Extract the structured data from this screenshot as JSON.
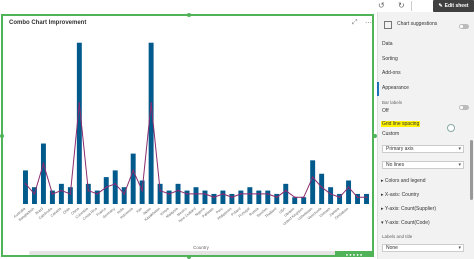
{
  "toolbar": {
    "undo_icon": "undo-icon",
    "redo_icon": "redo-icon",
    "edit_sheet_label": "Edit sheet"
  },
  "chart": {
    "title": "Combo Chart Improvement",
    "xlabel": "Country",
    "status_text": "● ● ● ● ●"
  },
  "chart_data": {
    "type": "bar",
    "categories": [
      "Australia",
      "Bangladesh",
      "Brazil",
      "Cambodia",
      "Canada",
      "Chile",
      "China",
      "Colombia",
      "Costa Rica",
      "France",
      "Germany",
      "India",
      "Indonesia",
      "Iran",
      "Japan",
      "Kazakhstan",
      "Kenya",
      "Malaysia",
      "Mexico",
      "New Zealand",
      "Nigeria",
      "Pakistan",
      "Peru",
      "Philippines",
      "Poland",
      "Portugal",
      "Russia",
      "Sweden",
      "Thailand",
      "USA",
      "Ukraine",
      "United Kingdom",
      "Uzbekistan",
      "Venezuela",
      "Vietnam",
      "Zambia",
      "Zimbabwe"
    ],
    "series": [
      {
        "type": "bar",
        "values": [
          10,
          5,
          18,
          4,
          6,
          5,
          48,
          6,
          4,
          8,
          10,
          5,
          15,
          7,
          48,
          6,
          4,
          6,
          4,
          5,
          4,
          3,
          4,
          3,
          4,
          5,
          4,
          4,
          3,
          6,
          2,
          2,
          13,
          9,
          5,
          3,
          7,
          3,
          3
        ]
      },
      {
        "type": "line",
        "values": [
          6,
          3,
          12,
          3,
          4,
          3,
          30,
          4,
          3,
          5,
          6,
          3,
          10,
          4,
          30,
          4,
          3,
          4,
          3,
          3,
          3,
          2,
          3,
          2,
          3,
          3,
          3,
          3,
          2,
          4,
          2,
          2,
          8,
          5,
          3,
          2,
          5,
          2,
          2
        ]
      }
    ],
    "ylim": [
      0,
      50
    ]
  },
  "props": {
    "suggestions_label": "Chart suggestions",
    "data_label": "Data",
    "sorting_label": "Sorting",
    "addons_label": "Add-ons",
    "appearance_label": "Appearance",
    "bar_labels_label": "Bar labels",
    "bar_labels_value": "Off",
    "grid_line_label": "Grid line spacing",
    "grid_line_value": "Custom",
    "primary_axis": "Primary axis",
    "lines_value": "No lines",
    "colors_legend": "Colors and legend",
    "xaxis_country": "X-axis: Country",
    "yaxis_supplier": "Y-axis: Count(Supplier)",
    "yaxis_code": "Y-axis: Count(Code)",
    "labels_title": "Labels and title",
    "labels_value": "None"
  },
  "colors": {
    "bar": "#005a8c",
    "line": "#8b2b6f",
    "accent": "#51b358",
    "highlight": "#fff200"
  }
}
